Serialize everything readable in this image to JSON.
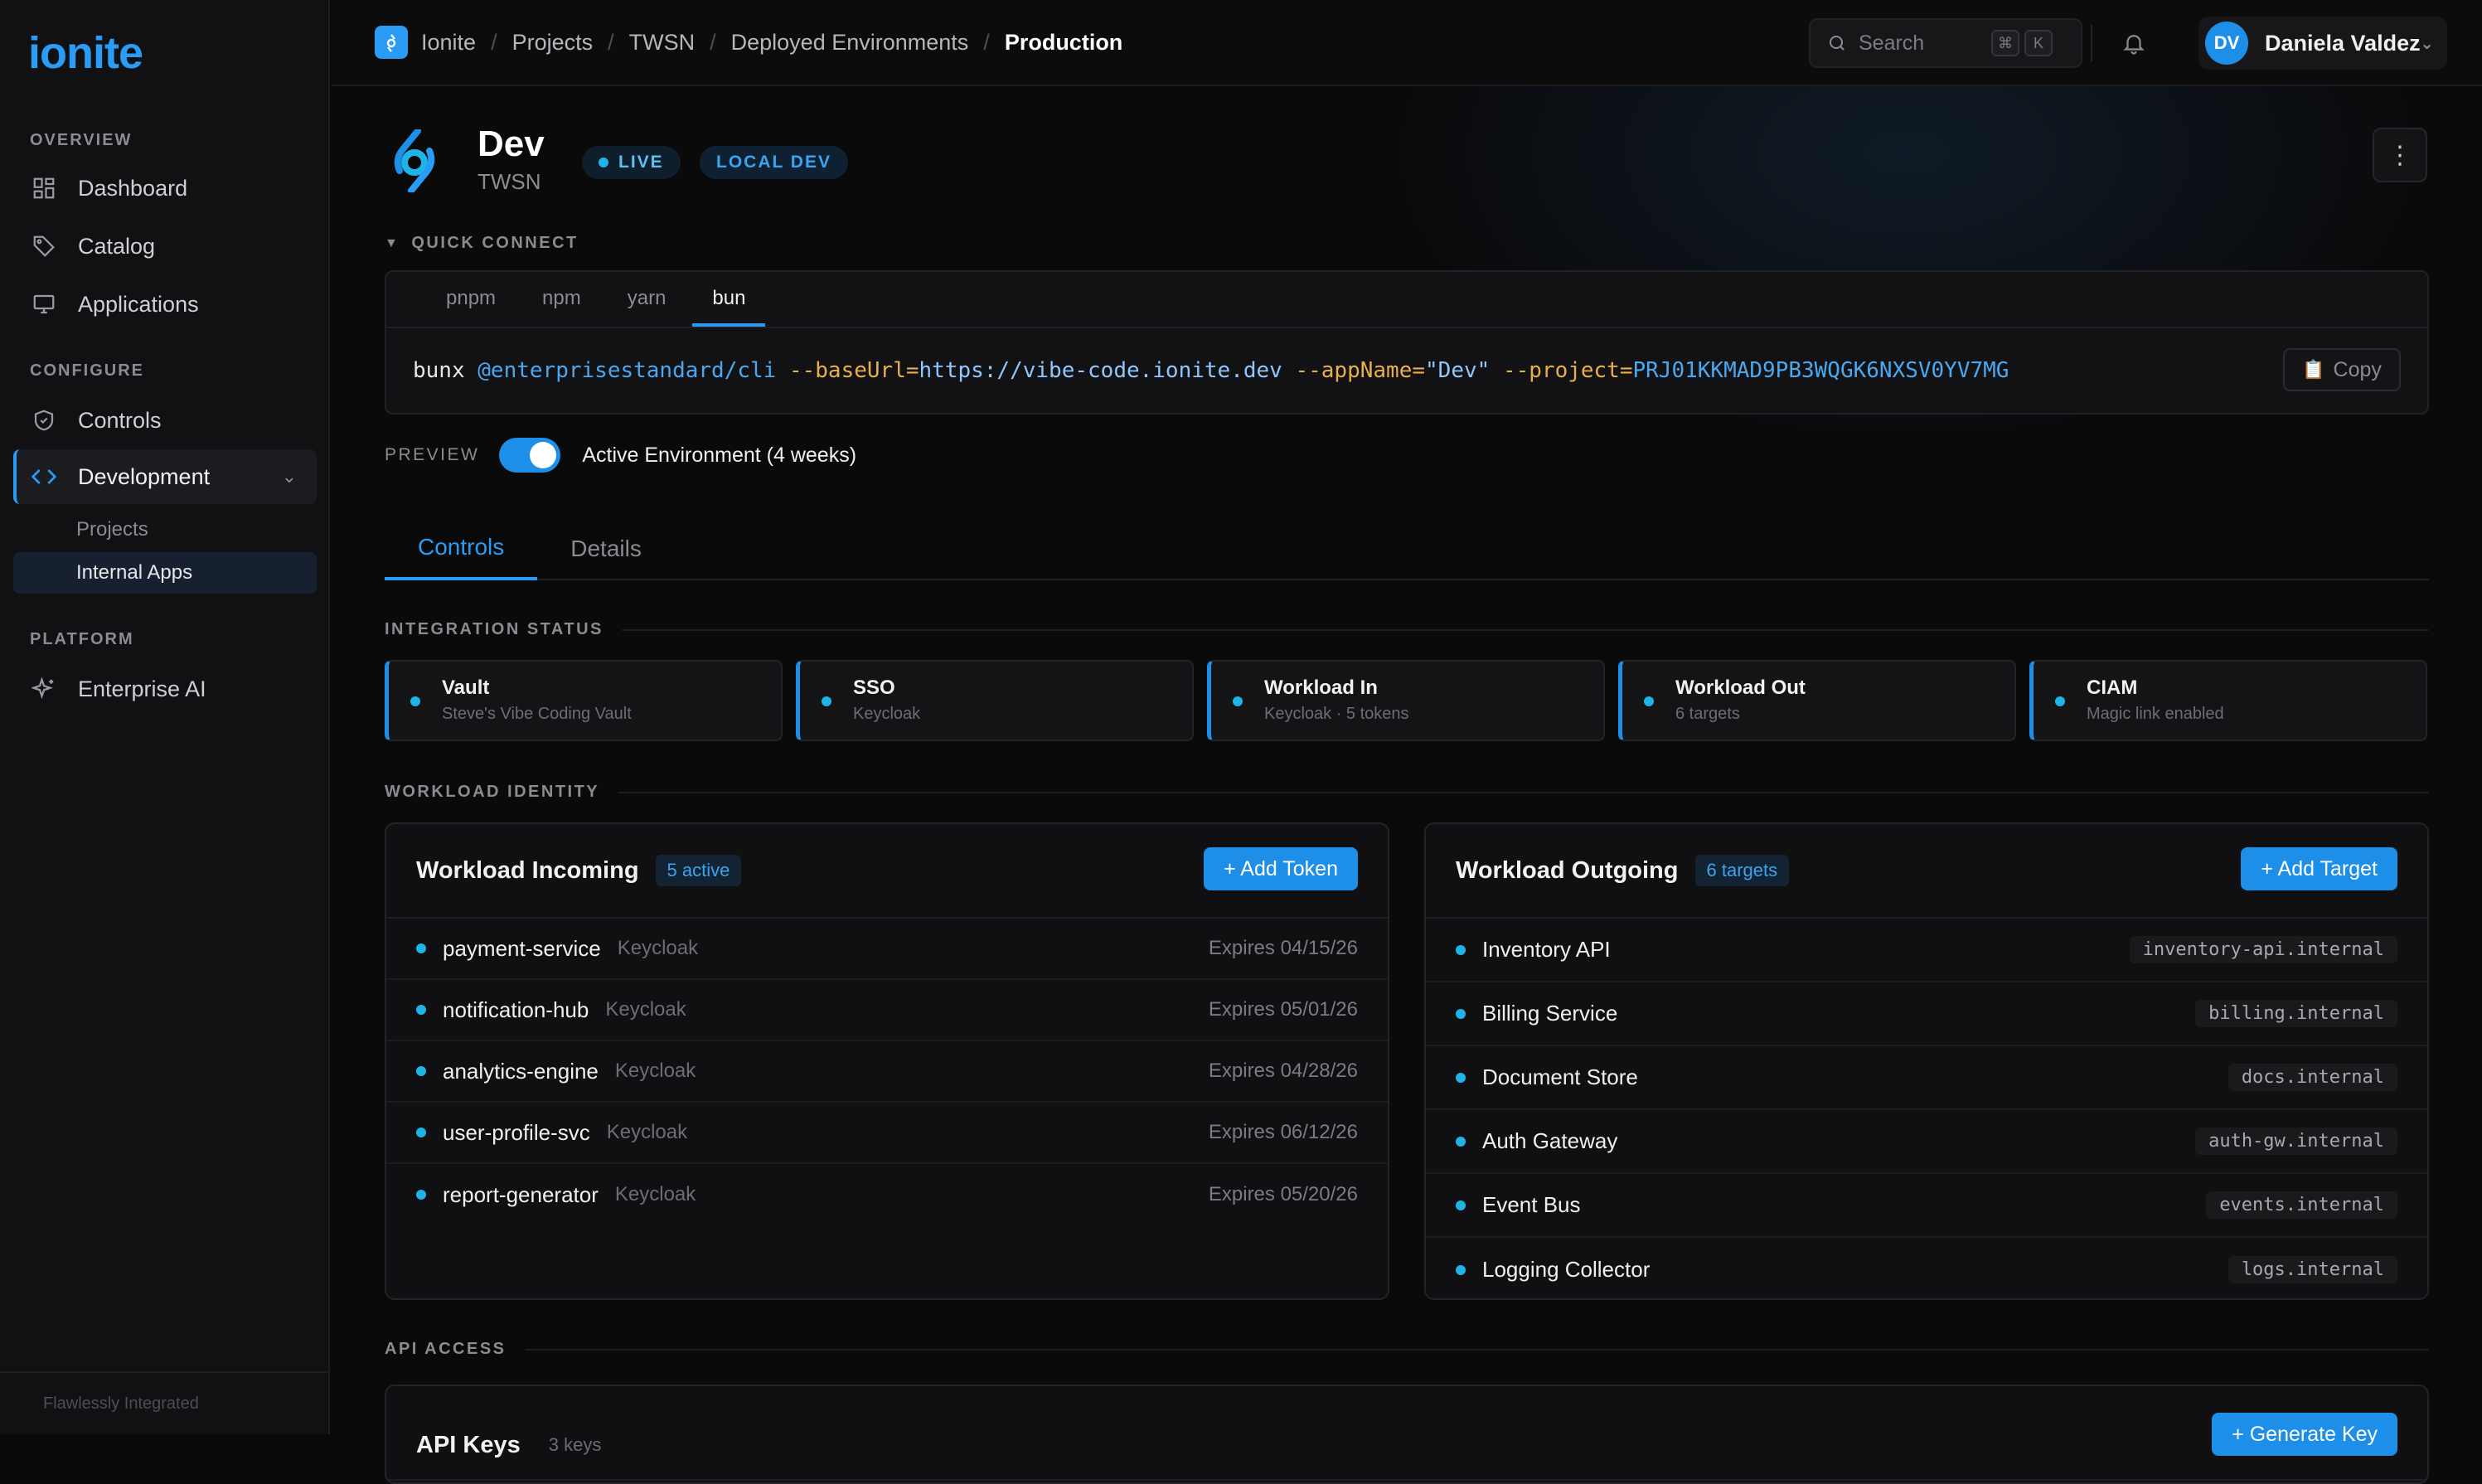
{
  "app": {
    "name": "ionite",
    "footer": "Flawlessly Integrated"
  },
  "sidebar": {
    "sections": [
      {
        "label": "OVERVIEW"
      },
      {
        "label": "CONFIGURE"
      },
      {
        "label": "PLATFORM"
      }
    ],
    "items": {
      "dashboard": "Dashboard",
      "catalog": "Catalog",
      "applications": "Applications",
      "controls": "Controls",
      "development": "Development",
      "projects": "Projects",
      "internal_apps": "Internal Apps",
      "enterprise_ai": "Enterprise AI"
    }
  },
  "breadcrumb": [
    "Ionite",
    "Projects",
    "TWSN",
    "Deployed Environments",
    "Production"
  ],
  "search": {
    "placeholder": "Search",
    "shortcut": [
      "⌘",
      "K"
    ]
  },
  "user": {
    "initials": "DV",
    "name": "Daniela Valdez"
  },
  "env": {
    "title": "Dev",
    "subtitle": "TWSN",
    "badge_live": "LIVE",
    "badge_local": "LOCAL DEV"
  },
  "quick_connect": {
    "label": "QUICK CONNECT",
    "tabs": [
      "pnpm",
      "npm",
      "yarn",
      "bun"
    ],
    "active_tab": "bun",
    "cmd": {
      "bin": "bunx",
      "pkg": "@enterprisestandard/cli",
      "flag1": "--baseUrl=",
      "val1": "https://vibe-code.ionite.dev",
      "flag2": "--appName=",
      "val2": "\"Dev\"",
      "flag3": "--project=",
      "val3": "PRJ01KKMAD9PB3WQGK6NXSV0YV7MG"
    },
    "copy": "Copy"
  },
  "preview": {
    "label": "PREVIEW",
    "text": "Active Environment (4 weeks)",
    "enabled": true
  },
  "tabs": [
    "Controls",
    "Details"
  ],
  "integration": {
    "label": "INTEGRATION STATUS",
    "cards": [
      {
        "title": "Vault",
        "sub": "Steve's Vibe Coding Vault"
      },
      {
        "title": "SSO",
        "sub": "Keycloak"
      },
      {
        "title": "Workload In",
        "sub": "Keycloak · 5 tokens"
      },
      {
        "title": "Workload Out",
        "sub": "6 targets"
      },
      {
        "title": "CIAM",
        "sub": "Magic link enabled"
      }
    ]
  },
  "workload": {
    "label": "WORKLOAD IDENTITY",
    "incoming": {
      "title": "Workload Incoming",
      "count": "5 active",
      "button": "+ Add Token",
      "rows": [
        {
          "name": "payment-service",
          "provider": "Keycloak",
          "expires": "Expires 04/15/26"
        },
        {
          "name": "notification-hub",
          "provider": "Keycloak",
          "expires": "Expires 05/01/26"
        },
        {
          "name": "analytics-engine",
          "provider": "Keycloak",
          "expires": "Expires 04/28/26"
        },
        {
          "name": "user-profile-svc",
          "provider": "Keycloak",
          "expires": "Expires 06/12/26"
        },
        {
          "name": "report-generator",
          "provider": "Keycloak",
          "expires": "Expires 05/20/26"
        }
      ]
    },
    "outgoing": {
      "title": "Workload Outgoing",
      "count": "6 targets",
      "button": "+ Add Target",
      "rows": [
        {
          "name": "Inventory API",
          "host": "inventory-api.internal"
        },
        {
          "name": "Billing Service",
          "host": "billing.internal"
        },
        {
          "name": "Document Store",
          "host": "docs.internal"
        },
        {
          "name": "Auth Gateway",
          "host": "auth-gw.internal"
        },
        {
          "name": "Event Bus",
          "host": "events.internal"
        },
        {
          "name": "Logging Collector",
          "host": "logs.internal"
        }
      ]
    }
  },
  "api": {
    "label": "API ACCESS",
    "title": "API Keys",
    "count": "3 keys",
    "button": "+ Generate Key"
  },
  "colors": {
    "accent": "#2a9cf5",
    "status_dot": "#1fb4e8",
    "background": "#0a0a0b"
  }
}
